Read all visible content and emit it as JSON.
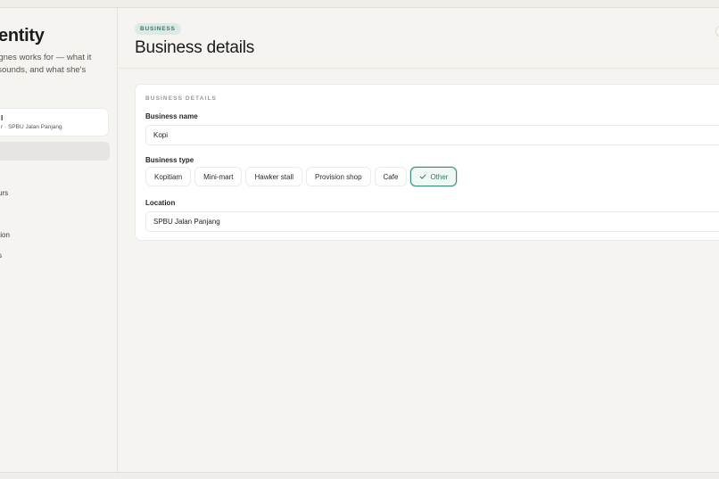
{
  "sidebar": {
    "title": "entity",
    "description_lines": [
      "Agnes works for — what it",
      "t sounds, and what she's"
    ],
    "profile_card": {
      "name": "l",
      "subtitle": "r · SPBU Jalan Panjang"
    },
    "items": [
      {
        "label": "urs"
      },
      {
        "label": "tion"
      },
      {
        "label": "s"
      }
    ]
  },
  "header": {
    "badge": "BUSINESS",
    "title": "Business details"
  },
  "form": {
    "section_label": "BUSINESS DETAILS",
    "business_name": {
      "label": "Business name",
      "value": "Kopi"
    },
    "business_type": {
      "label": "Business type",
      "options": [
        "Kopitiam",
        "Mini-mart",
        "Hawker stall",
        "Provision shop",
        "Cafe",
        "Other"
      ],
      "selected": "Other"
    },
    "location": {
      "label": "Location",
      "value": "SPBU Jalan Panjang"
    }
  },
  "colors": {
    "accent": "#2f7a6a",
    "badge_bg": "#dde9e5",
    "background": "#f5f4f1"
  }
}
